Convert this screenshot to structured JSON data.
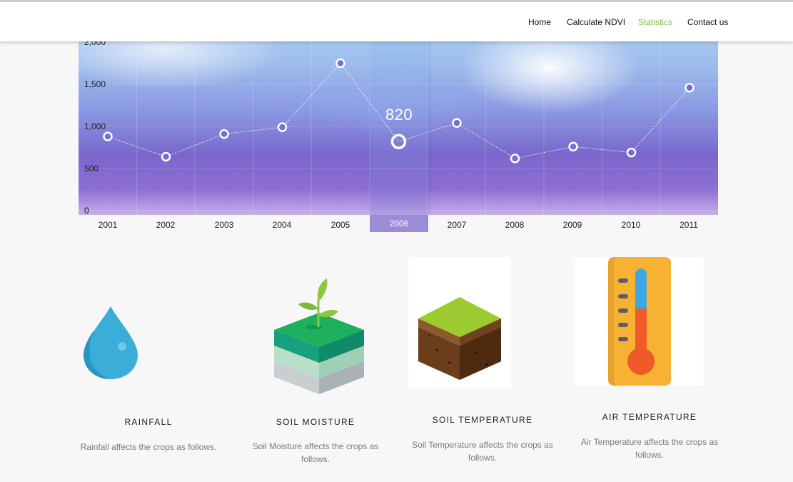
{
  "nav": {
    "items": [
      {
        "label": "Home"
      },
      {
        "label": "Calculate NDVI"
      },
      {
        "label": "Statistics"
      },
      {
        "label": "Contact us"
      }
    ],
    "active_index": 2,
    "active_color": "#7cc24f"
  },
  "chart_data": {
    "type": "line",
    "x": [
      "2001",
      "2002",
      "2003",
      "2004",
      "2005",
      "2006",
      "2007",
      "2008",
      "2009",
      "2010",
      "2011"
    ],
    "values": [
      880,
      640,
      910,
      990,
      1750,
      820,
      1040,
      620,
      760,
      690,
      1460
    ],
    "y_ticks": [
      "0",
      "500",
      "1,000",
      "1,500",
      "2,000"
    ],
    "ylim": [
      0,
      2000
    ],
    "highlight_category": "2006",
    "highlight_label": "820",
    "grid": true,
    "colors": {
      "highlight_band": "#9c8bd6",
      "points": "#ffffff"
    }
  },
  "cards": [
    {
      "icon": "water-drop-icon",
      "title": "RAINFALL",
      "desc": "Rainfall affects the crops as follows."
    },
    {
      "icon": "soil-moisture-icon",
      "title": "SOIL MOISTURE",
      "desc": "Soil Moisture affects the crops as follows."
    },
    {
      "icon": "soil-temperature-icon",
      "title": "SOIL TEMPERATURE",
      "desc": "Soil Temperature affects the crops as follows."
    },
    {
      "icon": "thermometer-icon",
      "title": "AIR TEMPERATURE",
      "desc": "Air Temperature affects the crops as follows."
    }
  ]
}
